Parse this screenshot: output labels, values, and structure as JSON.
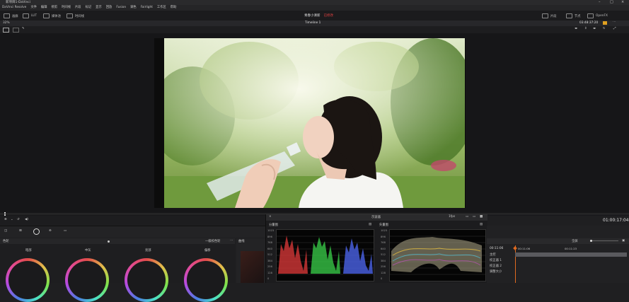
{
  "app": {
    "title": "新项目1-DaVinci",
    "project_title": "青春小清新",
    "project_status": "已修改"
  },
  "menu": [
    "DaVinci Resolve",
    "文件",
    "编辑",
    "修剪",
    "时间线",
    "片段",
    "标记",
    "显示",
    "回放",
    "Fusion",
    "调色",
    "Fairlight",
    "工作区",
    "帮助"
  ],
  "toolbar": {
    "left": [
      "画廊",
      "LUT",
      "媒体池",
      "时间线"
    ],
    "right": [
      "片段",
      "节点",
      "OpenFX"
    ]
  },
  "viewer": {
    "zoom": "32%",
    "timeline_name": "Timeline 1",
    "timecode": "03:48:37:20"
  },
  "transport": {
    "timecode": "01:00:17:04"
  },
  "wheels": {
    "section": "色轮",
    "mode": "一级校色轮",
    "curves": "曲线",
    "labels": [
      "暗部",
      "中灰",
      "亮部",
      "偏移"
    ]
  },
  "scopes": {
    "title": "示波器",
    "left_mode": "分量图",
    "right_mode": "矢量图",
    "setting": "1fps",
    "scale": [
      "1023",
      "896",
      "768",
      "640",
      "512",
      "384",
      "256",
      "128",
      "0"
    ]
  },
  "nodes": {
    "mode": "全屏",
    "timecode_left": "00:11:06",
    "timecode_right": "00:11:23",
    "list": [
      "主控",
      "校正器 1",
      "校正器 2",
      "调整大小"
    ]
  }
}
